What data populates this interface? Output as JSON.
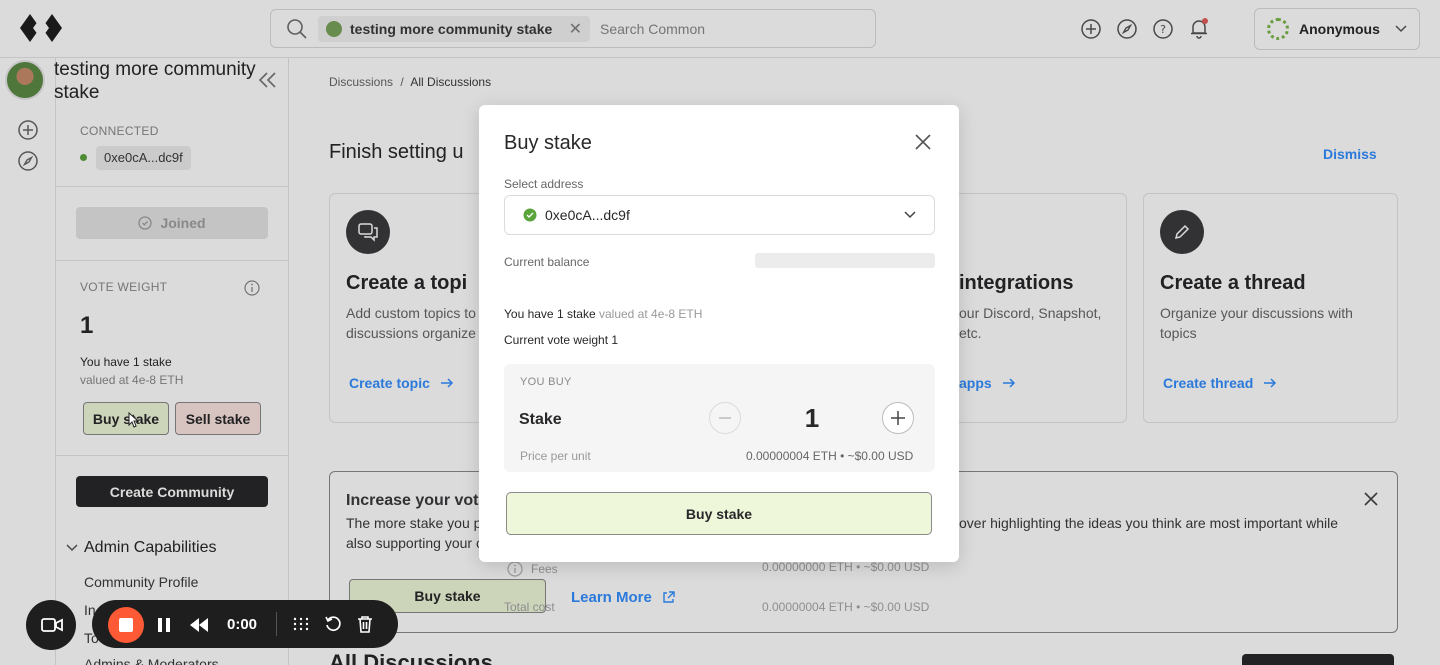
{
  "app": {
    "accent_color": "#338fff",
    "dark_color": "#282729"
  },
  "topbar": {
    "community_chip": "testing more community stake",
    "search_placeholder": "Search Common",
    "user_label": "Anonymous"
  },
  "sidebar": {
    "community_name": "testing more community stake",
    "connected_label": "CONNECTED",
    "address": "0xe0cA...dc9f",
    "joined_label": "Joined",
    "vote_weight_label": "VOTE WEIGHT",
    "vote_weight_value": "1",
    "stake_text": "You have 1 stake",
    "stake_value_text": "valued at 4e-8 ETH",
    "buy_stake": "Buy stake",
    "sell_stake": "Sell stake",
    "create_community": "Create Community",
    "admin_capabilities": "Admin Capabilities",
    "admin_items": [
      "Community Profile",
      "In",
      "To",
      "Admins & Moderators"
    ]
  },
  "main": {
    "breadcrumb_root": "Discussions",
    "breadcrumb_sep": "/",
    "breadcrumb_current": "All Discussions",
    "finish_title": "Finish setting u",
    "dismiss": "Dismiss",
    "cards": [
      {
        "title": "Create a topi",
        "desc": "Add custom topics to discussions organize",
        "link": "Create topic"
      },
      {
        "title": "integrations",
        "desc": "our Discord, Snapshot, etc.",
        "link": "apps"
      },
      {
        "title": "Create a thread",
        "desc": "Organize your discussions with topics",
        "link": "Create thread"
      }
    ],
    "banner_title": "Increase your vote",
    "banner_text_left": "The more stake you p",
    "banner_text_left2": "also supporting your c",
    "banner_text_right": "over highlighting the ideas you think are most important while",
    "banner_buy": "Buy stake",
    "learn_more": "Learn More",
    "fees_label": "Fees",
    "fees_value": "0.00000000 ETH • ~$0.00 USD",
    "total_label": "Total cost",
    "total_value": "0.00000004 ETH • ~$0.00 USD",
    "all_discussions": "All Discussions"
  },
  "modal": {
    "title": "Buy stake",
    "select_address_label": "Select address",
    "selected_address": "0xe0cA...dc9f",
    "current_balance_label": "Current balance",
    "have_stake": "You have 1 stake",
    "have_stake_value": "valued at 4e-8 ETH",
    "current_vote_weight": "Current vote weight 1",
    "you_buy_label": "YOU BUY",
    "stake_label": "Stake",
    "quantity": "1",
    "price_label": "Price per unit",
    "price_value": "0.00000004 ETH • ~$0.00 USD",
    "buy_button": "Buy stake"
  },
  "recorder": {
    "time": "0:00"
  }
}
